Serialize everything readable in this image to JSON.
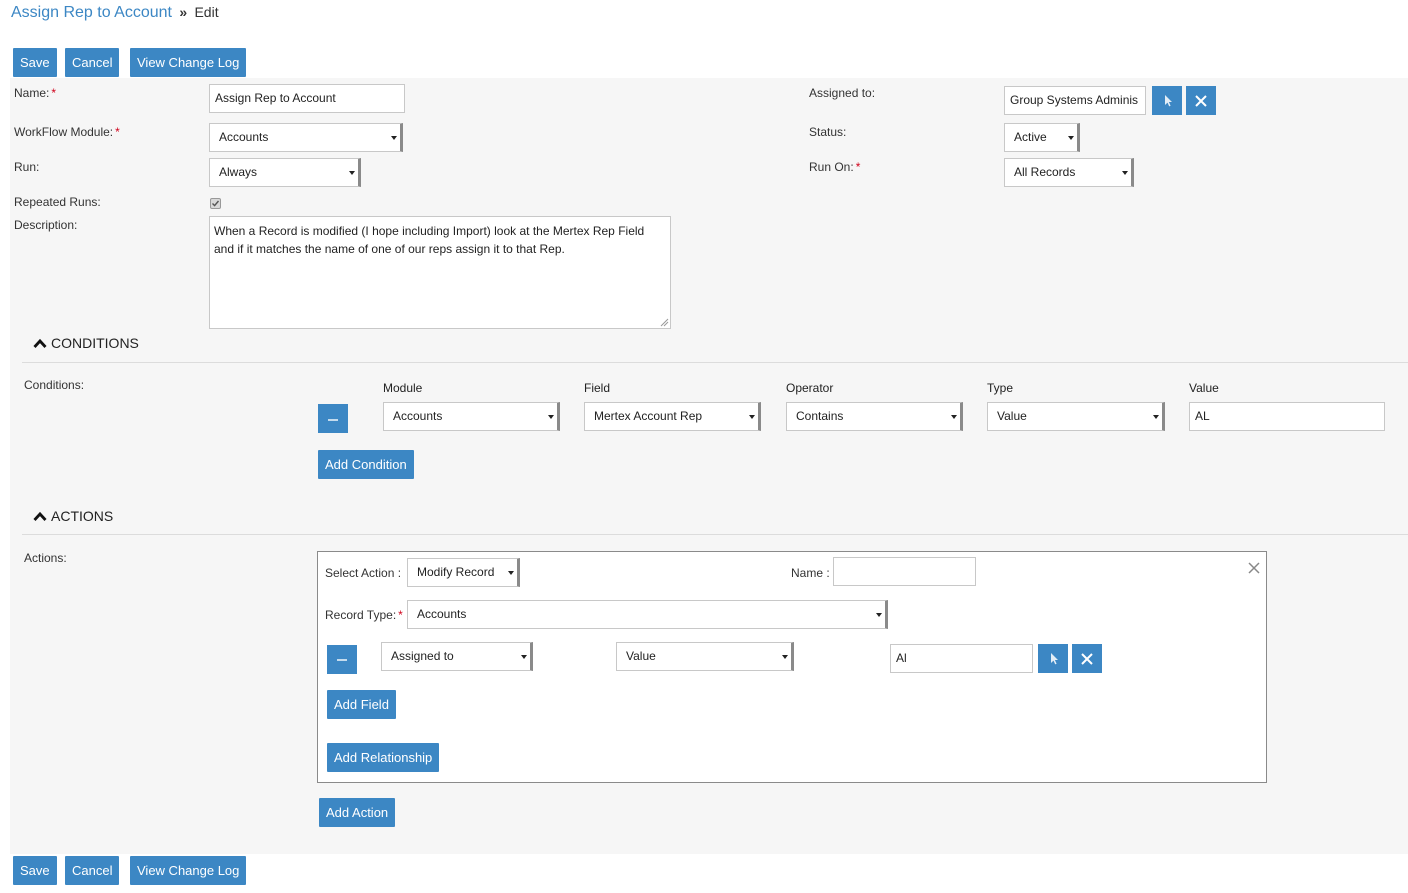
{
  "breadcrumb": {
    "module": "Assign Rep to Account",
    "separator": "»",
    "current": "Edit"
  },
  "toolbar": {
    "save": "Save",
    "cancel": "Cancel",
    "change_log": "View Change Log"
  },
  "form": {
    "name": {
      "label": "Name:",
      "value": "Assign Rep to Account"
    },
    "workflow_module": {
      "label": "WorkFlow Module:",
      "value": "Accounts"
    },
    "run": {
      "label": "Run:",
      "value": "Always"
    },
    "repeated_runs": {
      "label": "Repeated Runs:",
      "checked": true
    },
    "description": {
      "label": "Description:",
      "line1": "When a Record is modified (I hope including Import) look at the Mertex Rep Field",
      "line2": "and if it matches the name of one of our reps assign it to that Rep."
    },
    "assigned_to": {
      "label": "Assigned to:",
      "value": "Group Systems Adminis"
    },
    "status": {
      "label": "Status:",
      "value": "Active"
    },
    "run_on": {
      "label": "Run On:",
      "value": "All Records"
    },
    "required_mark": "*"
  },
  "conditions": {
    "section_title": "CONDITIONS",
    "label": "Conditions:",
    "columns": {
      "module": "Module",
      "field": "Field",
      "operator": "Operator",
      "type": "Type",
      "value": "Value"
    },
    "row": {
      "module": "Accounts",
      "field": "Mertex Account Rep",
      "operator": "Contains",
      "type": "Value",
      "value": "AL"
    },
    "add_button": "Add Condition"
  },
  "actions": {
    "section_title": "ACTIONS",
    "label": "Actions:",
    "select_action_label": "Select Action :",
    "select_action_value": "Modify Record",
    "name_label": "Name :",
    "name_value": "",
    "record_type_label": "Record Type:",
    "record_type_value": "Accounts",
    "field_row": {
      "field": "Assigned to",
      "type": "Value",
      "value": "Al"
    },
    "add_field": "Add Field",
    "add_relationship": "Add Relationship",
    "add_action": "Add Action"
  },
  "icons": {
    "section_toggle": "chevron-up-icon",
    "select": "select-arrow-icon",
    "clear": "clear-x-icon",
    "remove": "minus-icon",
    "close": "close-icon"
  },
  "colors": {
    "accent": "#3c87c4",
    "required": "#d0021b",
    "panel": "#f6f6f6"
  }
}
